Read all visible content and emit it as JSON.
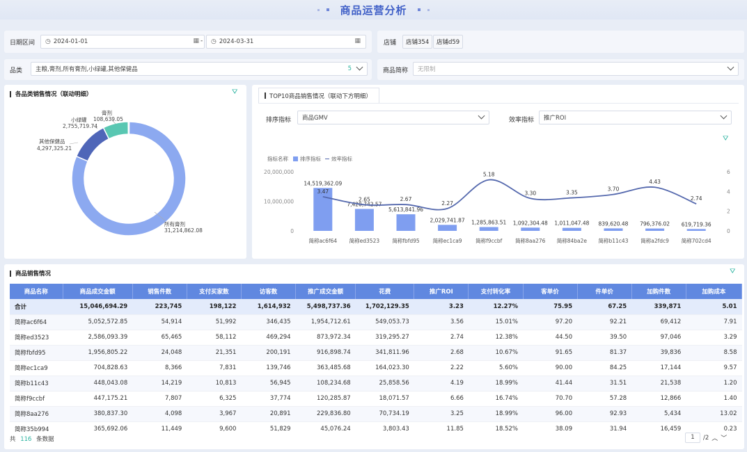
{
  "title": "商品运营分析",
  "filters": {
    "date_label": "日期区间",
    "date_start": "2024-01-01",
    "date_sep": "-",
    "date_end": "2024-03-31",
    "store_label": "店铺",
    "store_tags": [
      "店铺354",
      "店铺d59"
    ],
    "category_label": "品类",
    "category_value": "主粮,膏剂,所有膏剂,小绿罐,其他保健品",
    "category_count": "5",
    "product_label": "商品简称",
    "product_placeholder": "无限制"
  },
  "donut": {
    "title": "各品类销售情况（联动明细）",
    "labels": [
      {
        "name": "所有膏剂",
        "value": "31,214,862.08"
      },
      {
        "name": "其他保健品",
        "value": "4,297,325.21"
      },
      {
        "name": "小绿罐",
        "value": "2,755,719.74"
      },
      {
        "name": "膏剂",
        "value": "108,639.05"
      }
    ],
    "colors": [
      "#8ca9f0",
      "#4f66b8",
      "#59c7b2",
      "#a9c4ea"
    ]
  },
  "top10": {
    "tab_label": "TOP10商品销售情况（联动下方明细）",
    "sort_label": "排序指标",
    "sort_value": "商品GMV",
    "eff_label": "效率指标",
    "eff_value": "推广ROI",
    "legend_title": "指标名称",
    "legend_bar": "排序指标",
    "legend_line": "效率指标"
  },
  "chart_data": {
    "type": "bar",
    "categories": [
      "简称ac6f64",
      "简称ed3523",
      "简称fbfd95",
      "简称ec1ca9",
      "简称f9ccbf",
      "简称8aa276",
      "简称84ba2e",
      "简称b11c43",
      "简称a2fdc9",
      "简称702cd4"
    ],
    "series": [
      {
        "name": "排序指标",
        "type": "bar",
        "axis": "left",
        "values": [
          14519362.09,
          7420742.57,
          5613841.96,
          2029741.87,
          1285863.51,
          1092304.48,
          1011047.48,
          839620.48,
          796376.02,
          619719.36
        ],
        "labels": [
          "14,519,362.09",
          "7,420,742.57",
          "5,613,841.96",
          "2,029,741.87",
          "1,285,863.51",
          "1,092,304.48",
          "1,011,047.48",
          "839,620.48",
          "796,376.02",
          "619,719.36"
        ]
      },
      {
        "name": "效率指标",
        "type": "line",
        "axis": "right",
        "values": [
          3.47,
          2.65,
          2.67,
          2.27,
          5.18,
          3.3,
          3.35,
          3.7,
          4.43,
          2.74
        ],
        "labels": [
          "3.47",
          "2.65",
          "2.67",
          "2.27",
          "5.18",
          "3.30",
          "3.35",
          "3.70",
          "4.43",
          "2.74"
        ]
      }
    ],
    "y_left_ticks": [
      "20,000,000",
      "10,000,000",
      "0"
    ],
    "y_right_ticks": [
      "6",
      "4",
      "2",
      "0"
    ],
    "ylim_left": [
      0,
      20000000
    ],
    "ylim_right": [
      0,
      6
    ],
    "colors": {
      "bar": "#7f9ef0",
      "line": "#5468ad"
    }
  },
  "sales_table": {
    "title": "商品销售情况",
    "columns": [
      "商品名称",
      "商品成交金额",
      "销售件数",
      "支付买家数",
      "访客数",
      "推广成交金额",
      "花费",
      "推广ROI",
      "支付转化率",
      "客单价",
      "件单价",
      "加购件数",
      "加购成本"
    ],
    "total": [
      "合计",
      "15,046,694.29",
      "223,745",
      "198,122",
      "1,614,932",
      "5,498,737.36",
      "1,702,129.35",
      "3.23",
      "12.27%",
      "75.95",
      "67.25",
      "339,871",
      "5.01"
    ],
    "rows": [
      [
        "简称ac6f64",
        "5,052,572.85",
        "54,914",
        "51,992",
        "346,435",
        "1,954,712.61",
        "549,053.73",
        "3.56",
        "15.01%",
        "97.20",
        "92.21",
        "69,412",
        "7.91"
      ],
      [
        "简称ed3523",
        "2,586,093.39",
        "65,465",
        "58,112",
        "469,294",
        "873,972.34",
        "319,295.27",
        "2.74",
        "12.38%",
        "44.50",
        "39.50",
        "97,046",
        "3.29"
      ],
      [
        "简称fbfd95",
        "1,956,805.22",
        "24,048",
        "21,351",
        "200,191",
        "916,898.74",
        "341,811.96",
        "2.68",
        "10.67%",
        "91.65",
        "81.37",
        "39,836",
        "8.58"
      ],
      [
        "简称ec1ca9",
        "704,828.63",
        "8,366",
        "7,831",
        "139,746",
        "363,485.68",
        "164,023.30",
        "2.22",
        "5.60%",
        "90.00",
        "84.25",
        "17,144",
        "9.57"
      ],
      [
        "简称b11c43",
        "448,043.08",
        "14,219",
        "10,813",
        "56,945",
        "108,234.68",
        "25,858.56",
        "4.19",
        "18.99%",
        "41.44",
        "31.51",
        "21,538",
        "1.20"
      ],
      [
        "简称f9ccbf",
        "447,175.21",
        "7,807",
        "6,325",
        "37,774",
        "120,285.87",
        "18,071.57",
        "6.66",
        "16.74%",
        "70.70",
        "57.28",
        "12,866",
        "1.40"
      ],
      [
        "简称8aa276",
        "380,837.30",
        "4,098",
        "3,967",
        "20,891",
        "229,836.80",
        "70,734.19",
        "3.25",
        "18.99%",
        "96.00",
        "92.93",
        "5,434",
        "13.02"
      ],
      [
        "简称35b994",
        "365,692.06",
        "11,449",
        "9,600",
        "51,829",
        "45,076.24",
        "3,803.43",
        "11.85",
        "18.52%",
        "38.09",
        "31.94",
        "16,459",
        "0.23"
      ]
    ],
    "footer_prefix": "共",
    "footer_count": "116",
    "footer_suffix": "条数据",
    "page_current": "1",
    "page_total": "/2"
  }
}
